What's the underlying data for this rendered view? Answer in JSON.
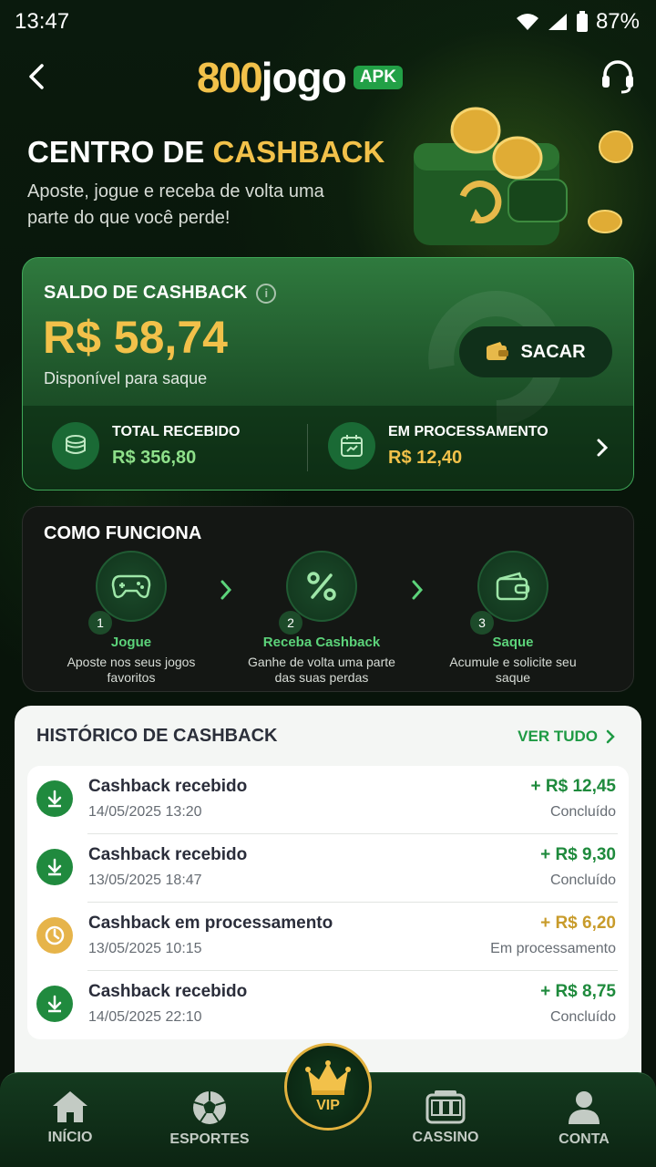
{
  "status_bar": {
    "time": "13:47",
    "battery": "87%"
  },
  "header": {
    "logo_number": "800",
    "logo_word": "jogo",
    "logo_badge": "APK"
  },
  "hero": {
    "title_white": "CENTRO DE ",
    "title_gold": "CASHBACK",
    "subtitle": "Aposte, jogue e receba de volta uma parte do que você perde!"
  },
  "balance": {
    "label": "SALDO DE CASHBACK",
    "amount": "R$ 58,74",
    "available": "Disponível para saque",
    "withdraw_label": "SACAR",
    "total_label": "TOTAL RECEBIDO",
    "total_value": "R$ 356,80",
    "processing_label": "EM PROCESSAMENTO",
    "processing_value": "R$ 12,40"
  },
  "how": {
    "title": "COMO FUNCIONA",
    "steps": [
      {
        "num": "1",
        "title": "Jogue",
        "desc": "Aposte nos seus jogos favoritos",
        "icon": "gamepad-icon"
      },
      {
        "num": "2",
        "title": "Receba Cashback",
        "desc": "Ganhe de volta uma parte das suas perdas",
        "icon": "percent-icon"
      },
      {
        "num": "3",
        "title": "Saque",
        "desc": "Acumule e solicite seu saque",
        "icon": "wallet-icon"
      }
    ]
  },
  "history": {
    "title": "HISTÓRICO DE CASHBACK",
    "see_all": "VER TUDO",
    "items": [
      {
        "title": "Cashback recebido",
        "date": "14/05/2025 13:20",
        "amount": "+ R$ 12,45",
        "status": "Concluído",
        "type": "received"
      },
      {
        "title": "Cashback recebido",
        "date": "13/05/2025 18:47",
        "amount": "+ R$ 9,30",
        "status": "Concluído",
        "type": "received"
      },
      {
        "title": "Cashback em processamento",
        "date": "13/05/2025 10:15",
        "amount": "+ R$ 6,20",
        "status": "Em processamento",
        "type": "processing"
      },
      {
        "title": "Cashback recebido",
        "date": "14/05/2025 22:10",
        "amount": "+ R$ 8,75",
        "status": "Concluído",
        "type": "received"
      }
    ]
  },
  "nav": {
    "home": "INÍCIO",
    "sports": "ESPORTES",
    "vip": "VIP",
    "casino": "CASSINO",
    "account": "CONTA"
  },
  "colors": {
    "gold": "#f2c14a",
    "green": "#1e9a44",
    "dark_bg": "#07120a"
  }
}
